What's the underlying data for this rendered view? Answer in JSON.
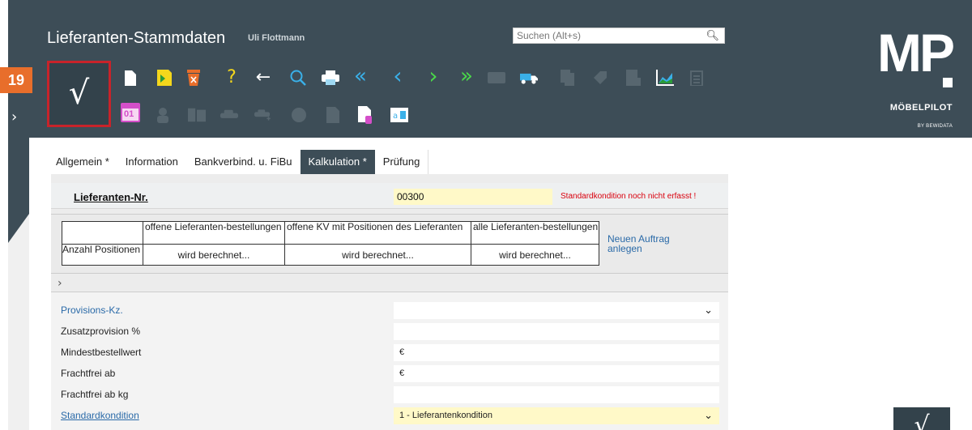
{
  "header": {
    "title": "Lieferanten-Stammdaten",
    "user": "Uli Flottmann",
    "search_placeholder": "Suchen (Alt+s)",
    "save_glyph": "√",
    "step_badge": "19",
    "colors": {
      "header_bg": "#3d4d57",
      "accent": "#e86e2b",
      "highlight_border": "#c8232a"
    }
  },
  "logo": {
    "mark": "MP",
    "name": "MÖBELPILOT",
    "sub": "BY BEWIDATA"
  },
  "toolbar": {
    "icons_row1": [
      "new-document-icon",
      "bookmark-icon",
      "delete-icon",
      "help-icon",
      "back-dropdown-icon",
      "search-icon",
      "print-icon",
      "first-record-icon",
      "previous-record-icon",
      "next-record-icon",
      "last-record-icon",
      "keyboard-icon",
      "truck-icon",
      "copy-icon",
      "tag-icon",
      "book-icon",
      "chart-icon",
      "clipboard-icon"
    ],
    "icons_row2": [
      "calendar-icon",
      "person-icon",
      "books-icon",
      "car-icon",
      "car-add-icon",
      "disc-icon",
      "document-icon",
      "document-edit-icon",
      "text-field-icon"
    ],
    "calendar_day": "01",
    "help_glyph": "?",
    "back_glyph": "←",
    "nav_first": "«",
    "nav_prev": "‹",
    "nav_next": "›",
    "nav_last": "»"
  },
  "tabs": [
    {
      "label": "Allgemein *"
    },
    {
      "label": "Information"
    },
    {
      "label": "Bankverbind. u. FiBu"
    },
    {
      "label": "Kalkulation *"
    },
    {
      "label": "Prüfung"
    }
  ],
  "supplier": {
    "label": "Lieferanten-Nr.",
    "value": "00300",
    "warning": "Standardkondition noch nicht erfasst !"
  },
  "stats": {
    "col1": "offene Lieferanten-bestellungen",
    "col2": "offene KV mit Positionen des Lieferanten",
    "col3": "alle Lieferanten-bestellungen",
    "row_label": "Anzahl Positionen",
    "v1": "wird berechnet...",
    "v2": "wird berechnet...",
    "v3": "wird berechnet...",
    "new_order": "Neuen Auftrag anlegen"
  },
  "form": {
    "provision_label": "Provisions-Kz.",
    "provision_value": "",
    "zusatz_label": "Zusatzprovision %",
    "zusatz_value": "",
    "mindest_label": "Mindestbestellwert",
    "mindest_value": "€",
    "frachtfrei_label": "Frachtfrei ab",
    "frachtfrei_value": "€",
    "frachtfrei_kg_label": "Frachtfrei ab kg",
    "frachtfrei_kg_value": "",
    "standard_label": "Standardkondition",
    "standard_value": "1 - Lieferantenkondition"
  },
  "chevrons": {
    "down": "⌄",
    "right": "›"
  }
}
